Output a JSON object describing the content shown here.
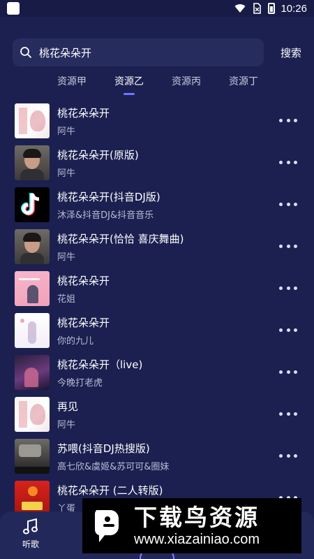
{
  "status_bar": {
    "time": "10:26",
    "icons": [
      "app-icon",
      "wifi-icon",
      "no-sim-icon",
      "battery-charging-icon"
    ]
  },
  "search": {
    "query": "桃花朵朵开",
    "button_label": "搜索",
    "icon": "search-icon"
  },
  "tabs": [
    {
      "label": "资源甲",
      "active": false
    },
    {
      "label": "资源乙",
      "active": true
    },
    {
      "label": "资源丙",
      "active": false
    },
    {
      "label": "资源丁",
      "active": false
    }
  ],
  "songs": [
    {
      "title": "桃花朵朵开",
      "artist": "阿牛"
    },
    {
      "title": "桃花朵朵开(原版)",
      "artist": "阿牛"
    },
    {
      "title": "桃花朵朵开(抖音DJ版)",
      "artist": "沐泽&抖音DJ&抖音音乐"
    },
    {
      "title": "桃花朵朵开(恰恰 喜庆舞曲)",
      "artist": "阿牛"
    },
    {
      "title": "桃花朵朵开",
      "artist": "花姐"
    },
    {
      "title": "桃花朵朵开",
      "artist": "你的九儿"
    },
    {
      "title": "桃花朵朵开（live)",
      "artist": "今晚打老虎"
    },
    {
      "title": "再见",
      "artist": "阿牛"
    },
    {
      "title": "苏喂(抖音DJ热搜版)",
      "artist": "高七欣&虞姬&苏可可&圈妹"
    },
    {
      "title": "桃花朵朵开 (二人转版)",
      "artist": "丫蛋"
    }
  ],
  "bottom_nav": {
    "listen_label": "听歌",
    "listen_icon": "music-note-icon"
  },
  "watermark": {
    "title": "下载鸟资源",
    "url": "www.xiazainiao.com"
  },
  "colors": {
    "background": "#1b2050",
    "accent": "#6d74ff",
    "search_bg": "#262c5e"
  }
}
